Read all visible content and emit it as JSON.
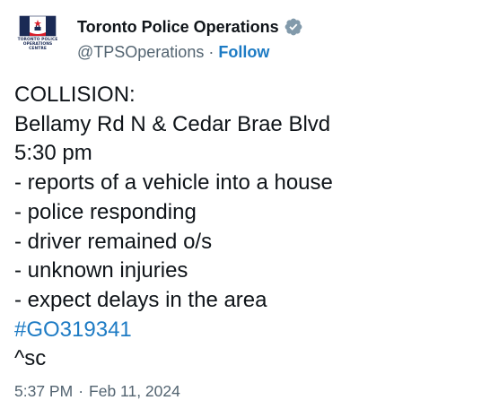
{
  "profile": {
    "display_name": "Toronto Police Operations",
    "handle": "@TPSOperations",
    "separator": "·",
    "follow_label": "Follow",
    "avatar_caption": [
      "TORONTO POLICE",
      "OPERATIONS",
      "CENTRE"
    ],
    "verified_badge": "grey-verified-icon"
  },
  "tweet": {
    "lines": [
      "COLLISION:",
      "Bellamy Rd N & Cedar Brae Blvd",
      "5:30 pm",
      "- reports of a vehicle into a house",
      "- police responding",
      "- driver remained o/s",
      "- unknown injuries",
      "- expect delays in the area"
    ],
    "hashtag": "#GO319341",
    "signature": "^sc"
  },
  "footer": {
    "time": "5:37 PM",
    "separator": "·",
    "date": "Feb 11, 2024"
  },
  "colors": {
    "text": "#0f1419",
    "muted": "#536471",
    "link": "#1d7bc4",
    "flag_navy": "#1a2a55",
    "flag_red": "#d81e2a",
    "badge_grey": "#829aab"
  }
}
